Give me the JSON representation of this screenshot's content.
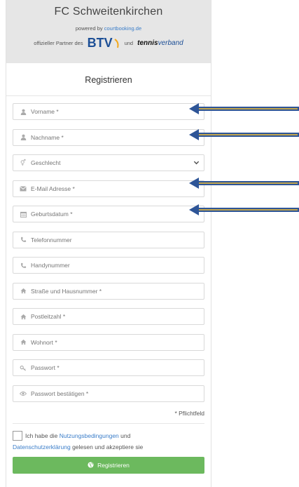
{
  "header": {
    "club_name": "FC Schweitenkirchen",
    "powered_prefix": "powered by",
    "powered_link": "courtbooking.de",
    "partner_text": "offizieller Partner des",
    "btv_logo": "BTV",
    "und": "und",
    "tennis_logo_main_bold": "tennis",
    "tennis_logo_main": "verband"
  },
  "form": {
    "title": "Registrieren",
    "fields": [
      {
        "icon": "user-icon",
        "placeholder": "Vorname *"
      },
      {
        "icon": "user-icon",
        "placeholder": "Nachname *"
      },
      {
        "icon": "gender-icon",
        "placeholder": "Geschlecht"
      },
      {
        "icon": "envelope-icon",
        "placeholder": "E-Mail Adresse *"
      },
      {
        "icon": "calendar-icon",
        "placeholder": "Geburtsdatum *"
      },
      {
        "icon": "phone-icon",
        "placeholder": "Telefonnummer"
      },
      {
        "icon": "phone-icon",
        "placeholder": "Handynummer"
      },
      {
        "icon": "home-icon",
        "placeholder": "Straße und Hausnummer *"
      },
      {
        "icon": "home-icon",
        "placeholder": "Postleitzahl *"
      },
      {
        "icon": "home-icon",
        "placeholder": "Wohnort *"
      },
      {
        "icon": "key-icon",
        "placeholder": "Passwort *"
      },
      {
        "icon": "eye-icon",
        "placeholder": "Passwort bestätigen *"
      }
    ],
    "required_note": "* Pflichtfeld",
    "agree_prefix": "Ich habe die",
    "terms_link": "Nutzungsbedingungen",
    "agree_und": "und",
    "privacy_link": "Datenschutzerklärung",
    "agree_suffix": "gelesen und akzeptiere sie",
    "submit_label": "Registrieren"
  },
  "colors": {
    "arrow_fill": "#2e5597",
    "arrow_line": "#f2c037",
    "submit_bg": "#6cb95e",
    "link": "#3a7dc9"
  }
}
